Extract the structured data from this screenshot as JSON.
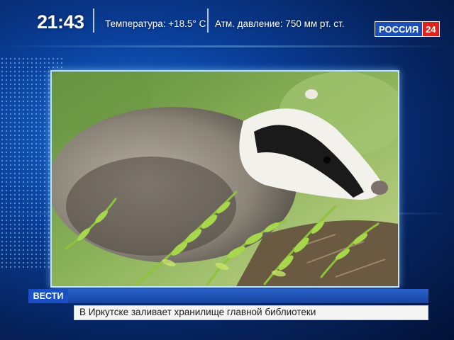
{
  "broadcast": {
    "clock": "21:43",
    "weather_temperature": "Температура: +18.5° C",
    "weather_pressure": "Атм. давление: 750 мм рт. ст.",
    "channel_name": "РОССИЯ",
    "channel_number": "24"
  },
  "lower_third": {
    "brand": "ВЕСТИ",
    "headline": "В Иркутске заливает хранилище главной библиотеки"
  },
  "colors": {
    "logo_blue": "#1d4fb5",
    "logo_red": "#d9241c",
    "vesti_blue": "#1a50c4"
  }
}
